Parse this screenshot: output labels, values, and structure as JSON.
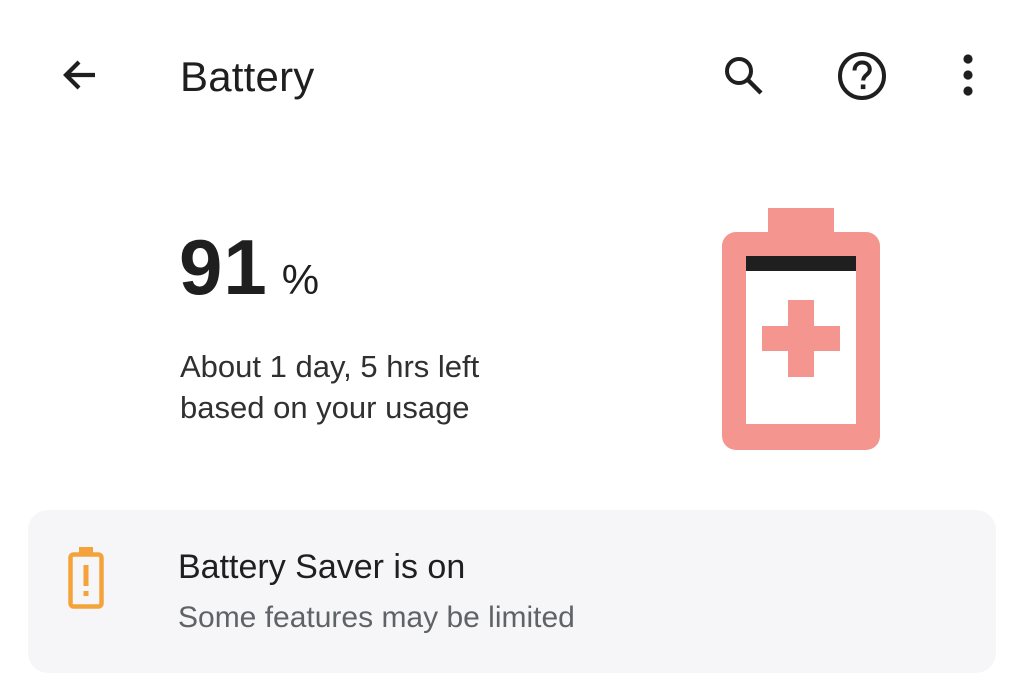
{
  "app_bar": {
    "title": "Battery",
    "icons": {
      "back": "arrow-back-icon",
      "search": "search-icon",
      "help": "help-icon",
      "more": "more-vert-icon"
    }
  },
  "battery": {
    "level_value": "91",
    "level_unit": "%",
    "level_percent": 91,
    "estimate_line1": "About 1 day, 5 hrs left",
    "estimate_line2": "based on your usage",
    "graphic_icon": "battery-saver-plus-icon",
    "graphic_color": "#f5958f"
  },
  "saver_card": {
    "icon": "battery-alert-icon",
    "icon_color": "#f3a33a",
    "title": "Battery Saver is on",
    "subtitle": "Some features may be limited"
  }
}
